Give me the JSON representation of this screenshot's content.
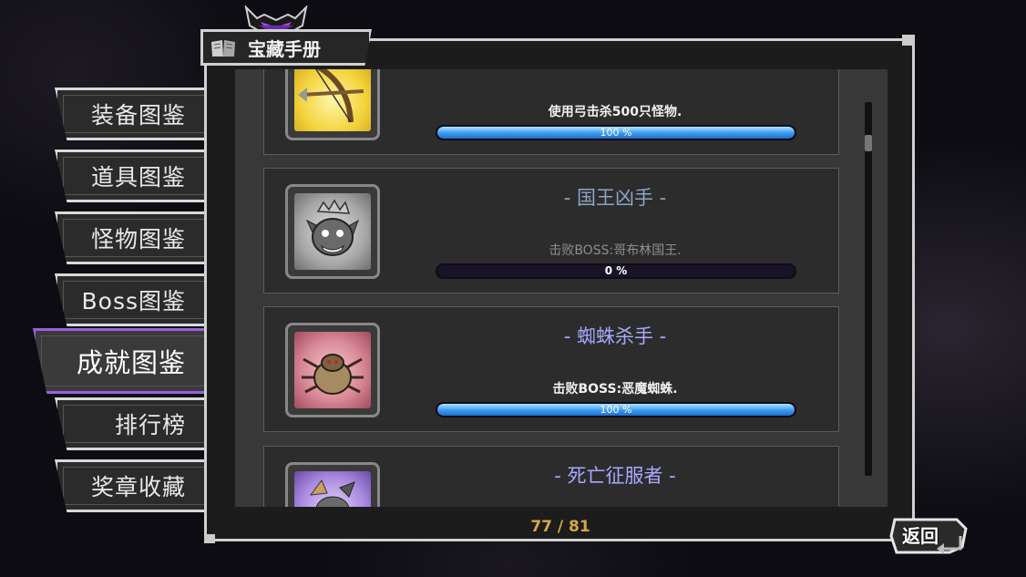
{
  "window": {
    "title": "宝藏手册"
  },
  "sidebar": {
    "items": [
      {
        "label": "装备图鉴"
      },
      {
        "label": "道具图鉴"
      },
      {
        "label": "怪物图鉴"
      },
      {
        "label": "Boss图鉴"
      },
      {
        "label": "成就图鉴",
        "active": true
      },
      {
        "label": "排行榜"
      },
      {
        "label": "奖章收藏"
      }
    ]
  },
  "achievements": [
    {
      "name": "",
      "desc": "使用弓击杀500只怪物.",
      "progress": 100,
      "progress_label": "100 %",
      "icon": "bow-arrow-icon",
      "completed": true
    },
    {
      "name": "- 国王凶手 -",
      "desc": "击败BOSS:哥布林国王.",
      "progress": 0,
      "progress_label": "0 %",
      "icon": "goblin-king-icon",
      "completed": false
    },
    {
      "name": "- 蜘蛛杀手 -",
      "desc": "击败BOSS:恶魔蜘蛛.",
      "progress": 100,
      "progress_label": "100 %",
      "icon": "demon-spider-icon",
      "completed": true
    },
    {
      "name": "- 死亡征服者 -",
      "desc": "",
      "icon": "death-conqueror-icon",
      "completed": true
    }
  ],
  "footer": {
    "counter": "77 / 81",
    "back_label": "返回"
  },
  "colors": {
    "active_tab_border": "#9b5fe0",
    "completed_name": "#a8a8ff",
    "incomplete_name": "#8ea3c6",
    "progress_fill": "#3a9bef",
    "counter": "#d6a64a"
  }
}
